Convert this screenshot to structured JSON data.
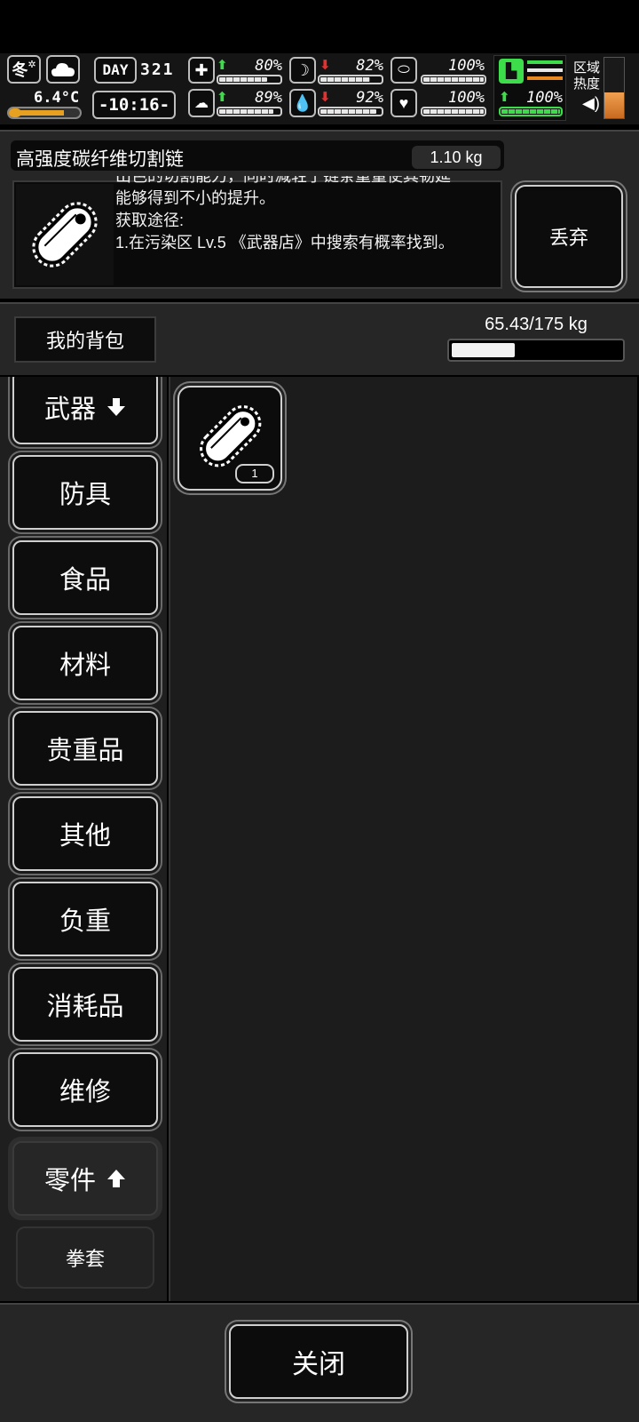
{
  "hud": {
    "season": "冬",
    "temperature": "6.4°C",
    "day_label": "DAY",
    "day_number": "321",
    "time": "-10:16-",
    "stats": {
      "health": {
        "value": "80%",
        "fill": 80,
        "trend": "up"
      },
      "stomach": {
        "value": "82%",
        "fill": 82,
        "trend": "down"
      },
      "pill": {
        "value": "100%",
        "fill": 100,
        "trend": "none"
      },
      "brain": {
        "value": "89%",
        "fill": 89,
        "trend": "up"
      },
      "water": {
        "value": "92%",
        "fill": 92,
        "trend": "down"
      },
      "heart": {
        "value": "100%",
        "fill": 100,
        "trend": "none"
      },
      "stamina": {
        "value": "100%",
        "fill": 100,
        "trend": "up"
      }
    },
    "zone_heat_label_line1": "区域",
    "zone_heat_label_line2": "热度"
  },
  "item": {
    "name": "高强度碳纤维切割链",
    "weight": "1.10 kg",
    "description_lines": [
      "出色的切割能力，同时减轻了链条重量使其韧延",
      "能够得到不小的提升。",
      "获取途径:",
      "1.在污染区 Lv.5 《武器店》中搜索有概率找到。"
    ],
    "discard_label": "丢弃"
  },
  "backpack": {
    "title": "我的背包",
    "weight_text": "65.43/175 kg",
    "weight_fraction": 0.374
  },
  "categories": [
    {
      "label": "武器",
      "arrow": "down"
    },
    {
      "label": "防具"
    },
    {
      "label": "食品"
    },
    {
      "label": "材料"
    },
    {
      "label": "贵重品"
    },
    {
      "label": "其他"
    },
    {
      "label": "负重"
    },
    {
      "label": "消耗品"
    },
    {
      "label": "维修"
    },
    {
      "label": "零件",
      "arrow": "up",
      "active": true
    },
    {
      "label": "拳套",
      "small": true
    }
  ],
  "inventory": [
    {
      "icon": "chainsaw-chain-icon",
      "count": "1"
    }
  ],
  "footer": {
    "close_label": "关闭"
  }
}
